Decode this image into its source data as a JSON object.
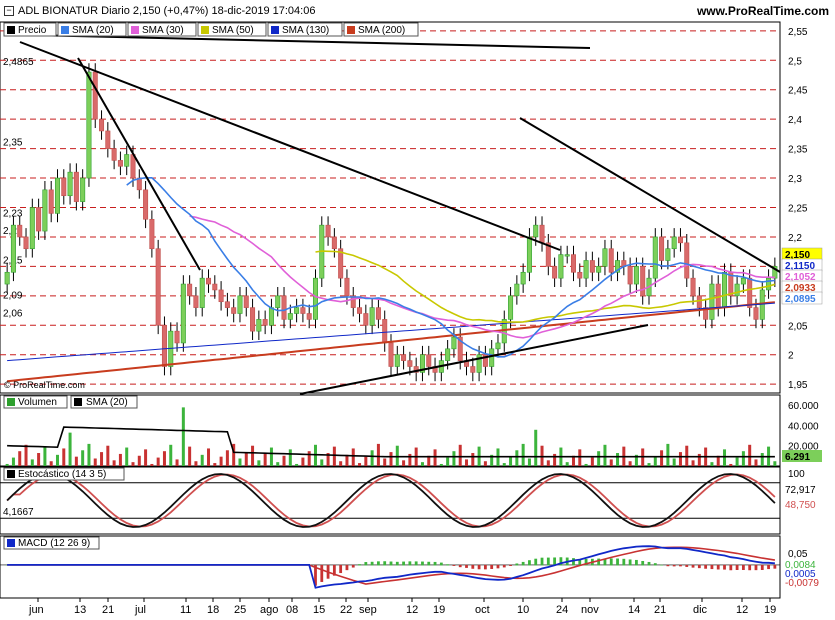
{
  "header": {
    "title": "ADL BIONATUR Diario 2,150 (+0,47%) 18-dic-2019 17:04:06",
    "site": "www.ProRealTime.com",
    "watermark": "© ProRealTime.com"
  },
  "chart_data": [
    {
      "type": "candlestick",
      "panel": "price",
      "legend": [
        {
          "name": "Precio",
          "color": "#000000"
        },
        {
          "name": "SMA (20)",
          "color": "#3a7ee6"
        },
        {
          "name": "SMA (30)",
          "color": "#e060d8"
        },
        {
          "name": "SMA (50)",
          "color": "#c8c800"
        },
        {
          "name": "SMA (130)",
          "color": "#1028c8"
        },
        {
          "name": "SMA (200)",
          "color": "#c83c1e"
        }
      ],
      "y_ticks": [
        "2,55",
        "2,5",
        "2,45",
        "2,4",
        "2,35",
        "2,3",
        "2,25",
        "2,2",
        "2,15",
        "2,1",
        "2,05",
        "2",
        "1,95"
      ],
      "ylim": [
        1.935,
        2.565
      ],
      "level_labels": [
        "2,4865",
        "2,35",
        "2,23",
        "2,2",
        "2,15",
        "2,09",
        "2,06"
      ],
      "last_labels": [
        {
          "text": "2,150",
          "bg": "#ffff00",
          "color": "#000000"
        },
        {
          "text": "2,1150",
          "bg": "#ffffff",
          "color": "#1028c8"
        },
        {
          "text": "2,1052",
          "bg": "#ffffff",
          "color": "#e060d8"
        },
        {
          "text": "2,0933",
          "bg": "#ffffff",
          "color": "#c83c1e"
        },
        {
          "text": "2,0895",
          "bg": "#ffffff",
          "color": "#3a7ee6"
        }
      ],
      "x_labels": [
        "jun",
        "13",
        "21",
        "jul",
        "11",
        "18",
        "25",
        "ago",
        "08",
        "15",
        "22",
        "sep",
        "12",
        "19",
        "oct",
        "10",
        "24",
        "nov",
        "14",
        "21",
        "dic",
        "12",
        "19"
      ],
      "close": [
        2.14,
        2.22,
        2.2,
        2.18,
        2.25,
        2.21,
        2.28,
        2.24,
        2.3,
        2.27,
        2.31,
        2.26,
        2.3,
        2.48,
        2.4,
        2.38,
        2.35,
        2.33,
        2.32,
        2.34,
        2.3,
        2.28,
        2.23,
        2.18,
        2.05,
        1.98,
        2.04,
        2.02,
        2.12,
        2.1,
        2.08,
        2.13,
        2.12,
        2.11,
        2.09,
        2.08,
        2.07,
        2.1,
        2.08,
        2.04,
        2.06,
        2.05,
        2.08,
        2.1,
        2.06,
        2.07,
        2.08,
        2.07,
        2.06,
        2.13,
        2.22,
        2.2,
        2.18,
        2.13,
        2.1,
        2.08,
        2.07,
        2.05,
        2.08,
        2.06,
        2.02,
        1.98,
        2.0,
        1.99,
        1.98,
        1.97,
        2.0,
        1.98,
        1.97,
        1.99,
        2.01,
        2.03,
        1.99,
        1.98,
        1.97,
        2.0,
        1.98,
        2.01,
        2.02,
        2.06,
        2.1,
        2.12,
        2.14,
        2.2,
        2.22,
        2.19,
        2.15,
        2.13,
        2.17,
        2.17,
        2.14,
        2.13,
        2.16,
        2.14,
        2.15,
        2.18,
        2.14,
        2.16,
        2.15,
        2.12,
        2.15,
        2.1,
        2.13,
        2.2,
        2.16,
        2.18,
        2.2,
        2.19,
        2.13,
        2.1,
        2.08,
        2.06,
        2.12,
        2.08,
        2.14,
        2.1,
        2.12,
        2.13,
        2.08,
        2.06,
        2.11,
        2.13,
        2.15
      ],
      "volume_ylim": [
        0,
        70000
      ],
      "volume_ticks": [
        "60.000",
        "40.000",
        "20.000"
      ],
      "volume_last": "6.291",
      "volume_legend": [
        "Volumen",
        "SMA (20)"
      ],
      "stoch_legend": "Estocástico (14 3 5)",
      "stoch_ticks": [
        "100"
      ],
      "stoch_level": "4,1667",
      "stoch_last": [
        "72,917",
        "48,750"
      ],
      "macd_legend": "MACD (12 26 9)",
      "macd_ticks": [
        "0,05"
      ],
      "macd_last": [
        "0,0084",
        "0,0005",
        "-0,0079"
      ]
    }
  ]
}
